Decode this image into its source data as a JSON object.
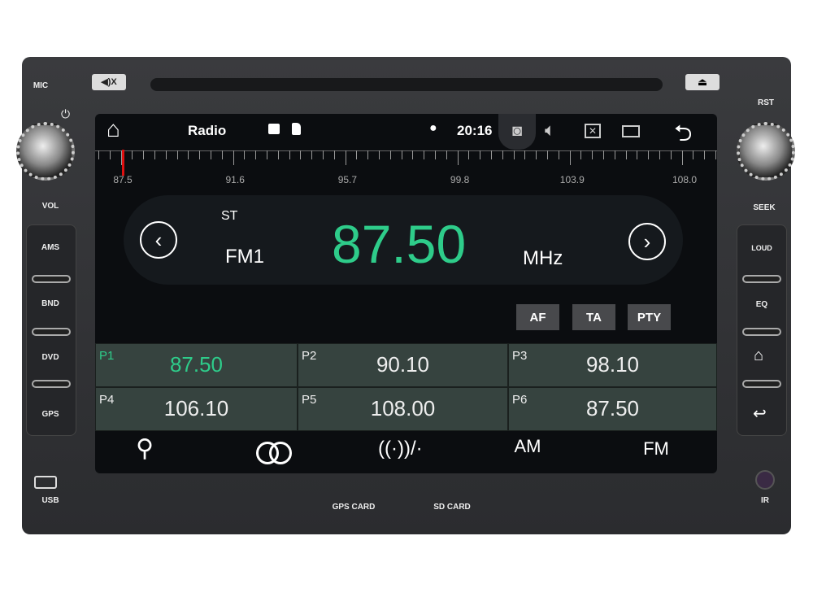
{
  "bezel": {
    "mic": "MIC",
    "mute": "◀)X",
    "vol": "VOL",
    "rst": "RST",
    "seek": "SEEK",
    "left_buttons": [
      "AMS",
      "BND",
      "DVD",
      "GPS"
    ],
    "right_buttons": [
      "LOUD",
      "EQ"
    ],
    "usb": "USB",
    "ir": "IR",
    "gps_card": "GPS CARD",
    "sd_card": "SD CARD"
  },
  "status": {
    "title": "Radio",
    "time": "20:16"
  },
  "ruler": {
    "labels": [
      "87.5",
      "91.6",
      "95.7",
      "99.8",
      "103.9",
      "108.0"
    ],
    "current": 87.5,
    "min": 87.5,
    "max": 108.0
  },
  "tuner": {
    "stereo": "ST",
    "band": "FM1",
    "frequency": "87.50",
    "unit": "MHz"
  },
  "rds": [
    "AF",
    "TA",
    "PTY"
  ],
  "presets": [
    {
      "n": "P1",
      "v": "87.50",
      "active": true
    },
    {
      "n": "P2",
      "v": "90.10"
    },
    {
      "n": "P3",
      "v": "98.10"
    },
    {
      "n": "P4",
      "v": "106.10"
    },
    {
      "n": "P5",
      "v": "108.00"
    },
    {
      "n": "P6",
      "v": "87.50"
    }
  ],
  "bottom": {
    "am": "AM",
    "fm": "FM"
  },
  "colors": {
    "accent": "#2ecc8a",
    "marker": "#e01010",
    "preset_bg": "#36433f"
  }
}
